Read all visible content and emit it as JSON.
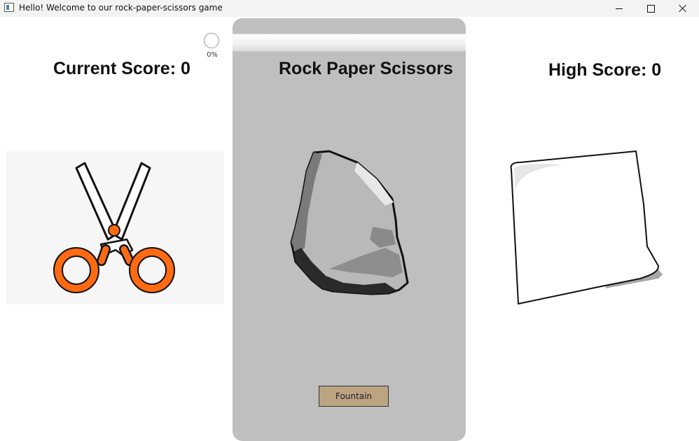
{
  "window": {
    "title": "Hello! Welcome to our rock-paper-scissors game",
    "icon": "app-window-icon",
    "controls": [
      "minimize-icon",
      "maximize-icon",
      "close-icon"
    ]
  },
  "progress": {
    "label": "0%",
    "value": 0
  },
  "scores": {
    "current_label": "Current Score: 0",
    "high_label": "High Score: 0"
  },
  "game": {
    "title": "Rock Paper Scissors",
    "button_label": "Fountain"
  },
  "images": {
    "player": "scissors",
    "center": "rock",
    "opponent": "paper"
  },
  "colors": {
    "panel": "#bfbfbf",
    "button": "#bca382",
    "scissors_handle": "#ff6a13"
  }
}
